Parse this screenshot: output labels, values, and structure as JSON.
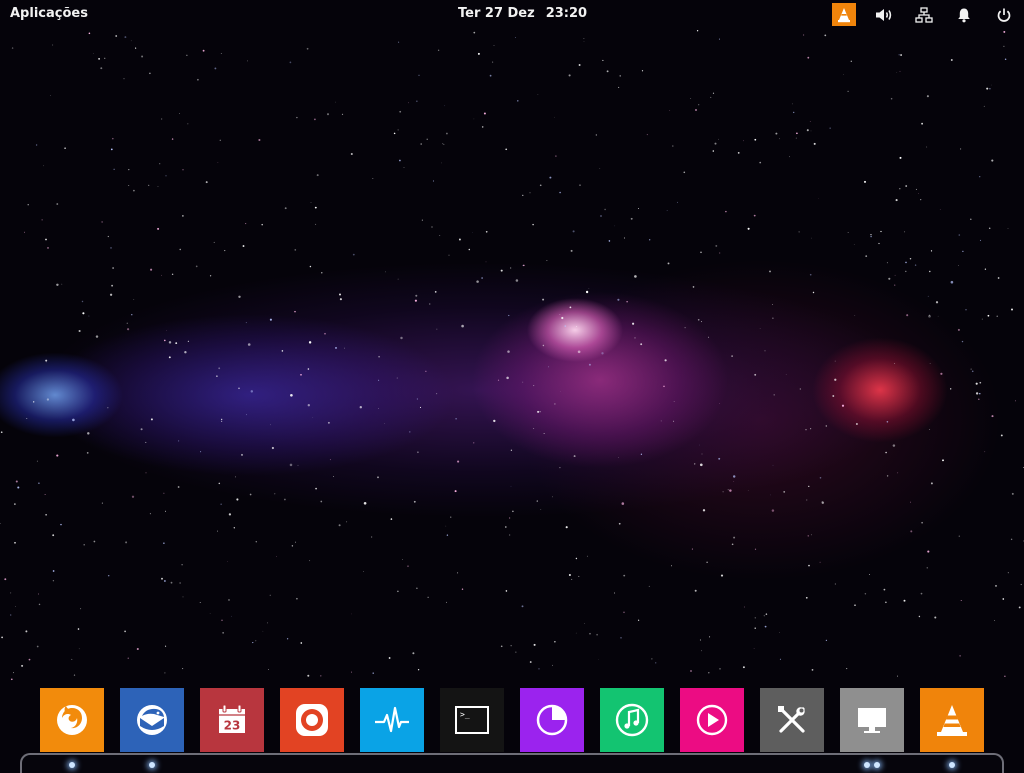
{
  "topbar": {
    "apps_label": "Aplicações",
    "date": "Ter 27 Dez",
    "time": "23:20",
    "tray_icons": [
      "vlc-icon",
      "volume-icon",
      "network-icon",
      "notifications-bell-icon",
      "power-icon"
    ]
  },
  "dock": {
    "items": [
      {
        "icon": "firefox-icon",
        "color": "#f28b0c"
      },
      {
        "icon": "thunderbird-icon",
        "color": "#2d63b8"
      },
      {
        "icon": "calendar-icon",
        "color": "#b8363e",
        "day": "23"
      },
      {
        "icon": "screen-recorder-icon",
        "color": "#e24323"
      },
      {
        "icon": "system-monitor-icon",
        "color": "#0aa3e6"
      },
      {
        "icon": "terminal-icon",
        "color": "#141414",
        "prompt": ">_"
      },
      {
        "icon": "disk-usage-icon",
        "color": "#9b23ee"
      },
      {
        "icon": "music-player-icon",
        "color": "#13c471"
      },
      {
        "icon": "video-player-icon",
        "color": "#ec0c83"
      },
      {
        "icon": "settings-tools-icon",
        "color": "#5e5e5e"
      },
      {
        "icon": "display-settings-icon",
        "color": "#8f8f8f"
      },
      {
        "icon": "vlc-icon",
        "color": "#f0840b"
      }
    ]
  },
  "colors": {
    "vlc_accent": "#f0840b",
    "topbar_text": "#f2f2f2"
  }
}
